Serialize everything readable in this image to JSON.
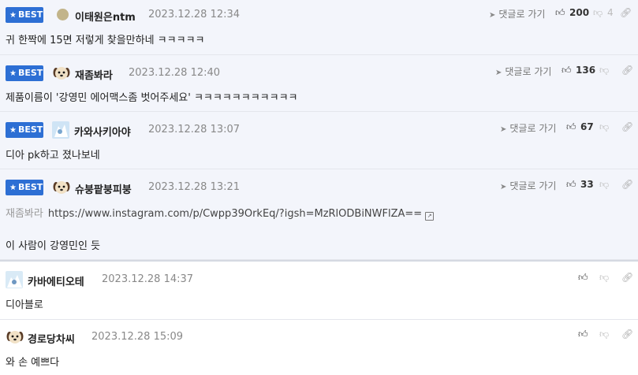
{
  "comments": [
    {
      "best": true,
      "badge": "BEST",
      "nick": "이태원은ntm",
      "date": "2023.12.28 12:34",
      "goto": "댓글로 가기",
      "likes": "200",
      "dislikes": "4",
      "text": "귀 한짝에 15면 저렇게 찾을만하네 ㅋㅋㅋㅋㅋ"
    },
    {
      "best": true,
      "badge": "BEST",
      "nick": "재좀봐라",
      "date": "2023.12.28 12:40",
      "goto": "댓글로 가기",
      "likes": "136",
      "text": "제품이름이 '강영민 에어맥스좀 벗어주세요' ㅋㅋㅋㅋㅋㅋㅋㅋㅋㅋㅋ"
    },
    {
      "best": true,
      "badge": "BEST",
      "nick": "카와사키아야",
      "date": "2023.12.28 13:07",
      "goto": "댓글로 가기",
      "likes": "67",
      "text": "디아 pk하고 졌나보네"
    },
    {
      "best": true,
      "badge": "BEST",
      "nick": "슈붕팥붕피붕",
      "date": "2023.12.28 13:21",
      "goto": "댓글로 가기",
      "likes": "33",
      "reply_to": "재좀봐라",
      "url": "https://www.instagram.com/p/Cwpp39OrkEq/?igsh=MzRlODBiNWFlZA==",
      "text": "이 사람이 강영민인 듯"
    },
    {
      "best": false,
      "nick": "카바에티오테",
      "date": "2023.12.28 14:37",
      "text": "디아블로"
    },
    {
      "best": false,
      "nick": "경로당차씨",
      "date": "2023.12.28 15:09",
      "text": "와 손 예쁘다"
    }
  ],
  "colors": {
    "best_badge": "#2d6fd4",
    "best_bg": "#f3f5fb"
  },
  "icons": {
    "star": "star-icon",
    "goto": "arrow-icon",
    "like": "thumbs-up-icon",
    "dislike": "thumbs-down-icon",
    "link": "link-icon",
    "external": "external-link-icon"
  }
}
